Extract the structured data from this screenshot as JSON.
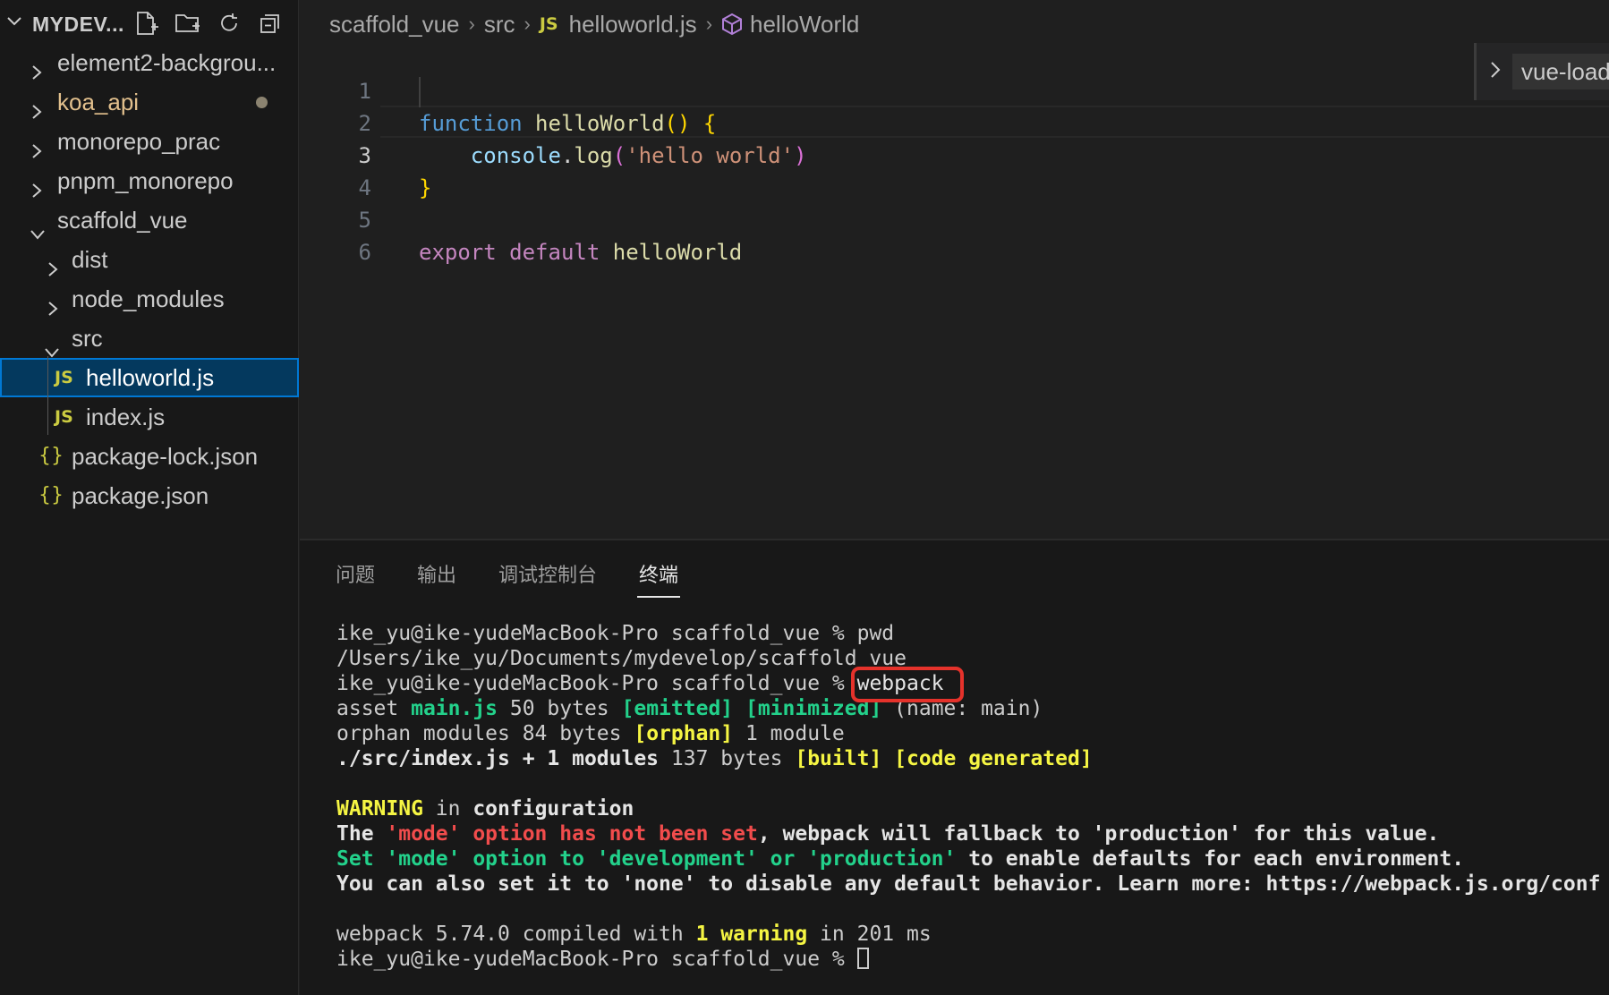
{
  "sidebar": {
    "title": "MYDEV...",
    "actions": [
      "new-file-icon",
      "new-folder-icon",
      "refresh-icon",
      "collapse-all-icon"
    ],
    "items": [
      {
        "label": "element2-backgrou...",
        "type": "folder",
        "expanded": false
      },
      {
        "label": "koa_api",
        "type": "folder",
        "expanded": false,
        "modified": true
      },
      {
        "label": "monorepo_prac",
        "type": "folder",
        "expanded": false
      },
      {
        "label": "pnpm_monorepo",
        "type": "folder",
        "expanded": false
      },
      {
        "label": "scaffold_vue",
        "type": "folder",
        "expanded": true
      },
      {
        "label": "dist",
        "type": "folder",
        "expanded": false
      },
      {
        "label": "node_modules",
        "type": "folder",
        "expanded": false
      },
      {
        "label": "src",
        "type": "folder",
        "expanded": true
      },
      {
        "label": "helloworld.js",
        "type": "js",
        "selected": true,
        "icon": "JS"
      },
      {
        "label": "index.js",
        "type": "js",
        "icon": "JS"
      },
      {
        "label": "package-lock.json",
        "type": "json",
        "icon": "{}"
      },
      {
        "label": "package.json",
        "type": "json",
        "icon": "{}"
      }
    ],
    "colors": {
      "modified_label": "#e2c08d",
      "selected_bg": "#04395e",
      "selected_border": "#0078d4"
    }
  },
  "breadcrumb": {
    "items": [
      "scaffold_vue",
      "src",
      "helloworld.js",
      "helloWorld"
    ],
    "js_badge": "JS"
  },
  "editor": {
    "line_numbers": [
      "1",
      "2",
      "3",
      "4",
      "5",
      "6"
    ],
    "active_line": "3",
    "lines": [
      {
        "t1": "function",
        "t2": " ",
        "t3": "helloWorld",
        "t4": "()",
        "t5": " ",
        "t6": "{"
      },
      {
        "t1": "    ",
        "t2": "console",
        "t3": ".",
        "t4": "log",
        "t5": "(",
        "t6": "'hello world'",
        "t7": ")"
      },
      {
        "t1": "}"
      },
      {},
      {
        "t1": "export",
        "t2": " ",
        "t3": "default",
        "t4": " ",
        "t5": "helloWorld"
      },
      {}
    ],
    "sticky_label": "vue-load"
  },
  "panel": {
    "tabs": [
      "问题",
      "输出",
      "调试控制台",
      "终端"
    ],
    "active_tab": "终端",
    "terminal": {
      "l1": "ike_yu@ike-yudeMacBook-Pro scaffold_vue % pwd",
      "l2": "/Users/ike_yu/Documents/mydevelop/scaffold_vue",
      "l3a": "ike_yu@ike-yudeMacBook-Pro scaffold_vue % ",
      "l3b": "webpack",
      "l4a": "asset ",
      "l4b": "main.js",
      "l4c": " 50 bytes ",
      "l4d": "[emitted] [minimized]",
      "l4e": " (name: main)",
      "l5a": "orphan modules 84 bytes ",
      "l5b": "[orphan]",
      "l5c": " 1 module",
      "l6a": "./src/index.js + 1 modules",
      "l6b": " 137 bytes ",
      "l6c": "[built] [code generated]",
      "l7a": "WARNING",
      "l7b": " in ",
      "l7c": "configuration",
      "l8a": "The ",
      "l8b": "'mode' option has not been set",
      "l8c": ", webpack will fallback to 'production' for this value.",
      "l9a": "Set 'mode' option to 'development' or 'production'",
      "l9b": " to enable defaults for each environment.",
      "l10": "You can also set it to 'none' to disable any default behavior. Learn more: https://webpack.js.org/conf",
      "l11a": "webpack 5.74.0 compiled with ",
      "l11b": "1 warning",
      "l11c": " in 201 ms",
      "l12": "ike_yu@ike-yudeMacBook-Pro scaffold_vue % "
    },
    "highlight_color": "#e5322b"
  }
}
